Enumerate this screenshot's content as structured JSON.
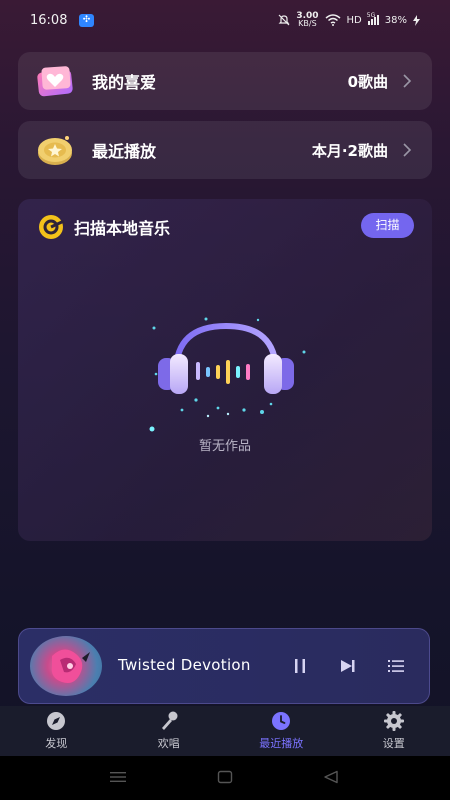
{
  "status_bar": {
    "time": "16:08",
    "speed_value": "3.00",
    "speed_unit": "KB/S",
    "hd": "HD",
    "network": "5G",
    "battery": "38%"
  },
  "favorites": {
    "label": "我的喜爱",
    "count": "0歌曲",
    "icon": "heart-folder-icon"
  },
  "recent": {
    "label": "最近播放",
    "count": "本月·2歌曲",
    "icon": "gold-coin-icon"
  },
  "scan": {
    "title": "扫描本地音乐",
    "button_label": "扫描",
    "empty_text": "暂无作品",
    "icon": "scan-target-icon"
  },
  "player": {
    "song_title": "Twisted Devotion",
    "controls": [
      "pause-icon",
      "next-icon",
      "playlist-icon"
    ]
  },
  "tabs": [
    {
      "label": "发现",
      "icon": "compass-icon",
      "active": false
    },
    {
      "label": "欢唱",
      "icon": "microphone-icon",
      "active": false
    },
    {
      "label": "最近播放",
      "icon": "clock-icon",
      "active": true
    },
    {
      "label": "设置",
      "icon": "gear-icon",
      "active": false
    }
  ],
  "colors": {
    "accent": "#7466ef",
    "active_tab": "#7b73ff",
    "card_bg": "#2e2438"
  }
}
